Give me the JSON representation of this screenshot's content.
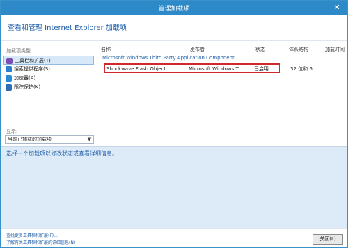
{
  "window": {
    "title": "管理加载项"
  },
  "header": {
    "heading": "查看和管理 Internet Explorer 加载项"
  },
  "sidebar": {
    "types_label": "加载项类型",
    "items": [
      {
        "label": "工具栏和扩展(T)",
        "icon": "gear-icon",
        "selected": true
      },
      {
        "label": "搜索提供程序(S)",
        "icon": "search-icon",
        "selected": false
      },
      {
        "label": "加速器(A)",
        "icon": "accelerator-icon",
        "selected": false
      },
      {
        "label": "跟踪保护(K)",
        "icon": "shield-icon",
        "selected": false
      }
    ],
    "show_label": "显示:",
    "show_value": "当前已加载的加载项"
  },
  "table": {
    "columns": [
      "名称",
      "发布者",
      "状态",
      "体系结构",
      "加载时间"
    ],
    "group_title": "Microsoft Windows Third Party Application Component",
    "rows": [
      {
        "name": "Shockwave Flash Object",
        "publisher": "Microsoft Windows T...",
        "status": "已启用",
        "architecture": "32 位和 6...",
        "load_time": ""
      }
    ]
  },
  "details": {
    "hint": "选择一个加载项以修改状态或查看详细信息。"
  },
  "footer": {
    "link_find": "查找更多工具栏和扩展(F)...",
    "link_learn": "了解有关工具栏和扩展的详细信息(N)",
    "close_label": "关闭(L)"
  },
  "colors": {
    "accent": "#2d89c7",
    "highlight_border": "#d0282d",
    "details_bg": "#ddeaf7"
  }
}
